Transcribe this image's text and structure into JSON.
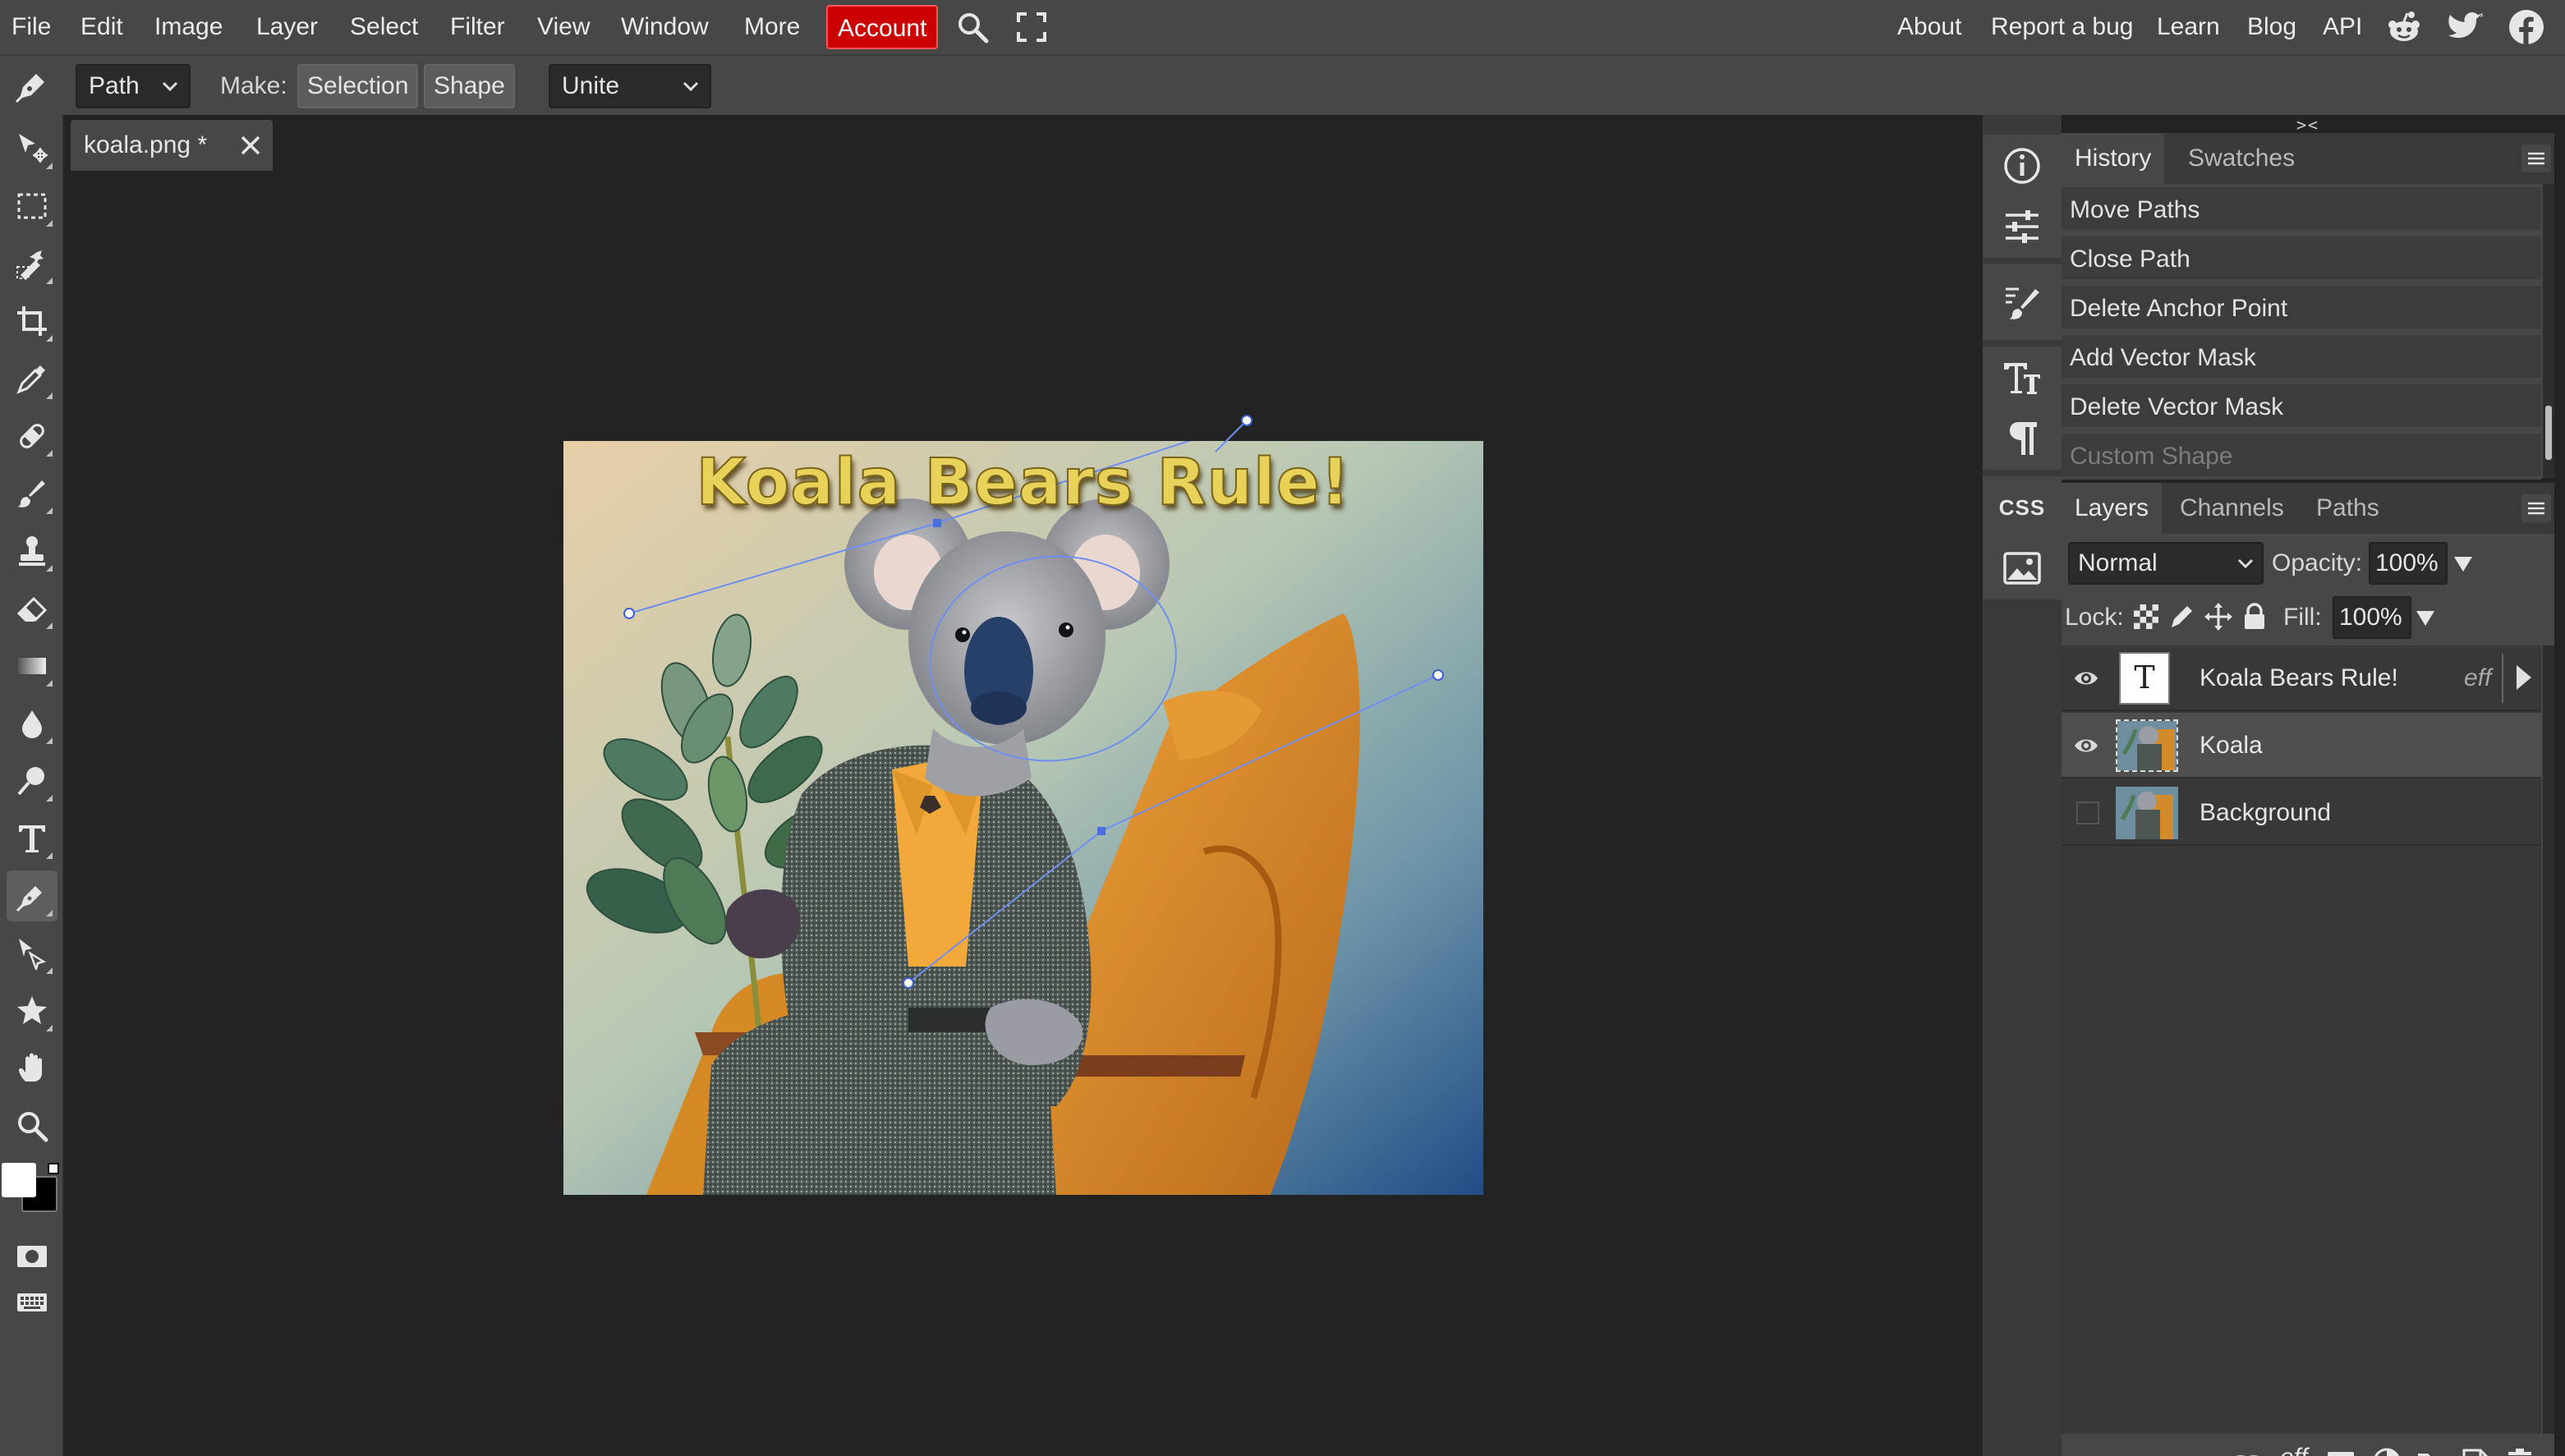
{
  "menu": {
    "items": [
      "File",
      "Edit",
      "Image",
      "Layer",
      "Select",
      "Filter",
      "View",
      "Window",
      "More"
    ],
    "account": "Account",
    "right_links": [
      "About",
      "Report a bug",
      "Learn",
      "Blog",
      "API"
    ],
    "icons": [
      "search-icon",
      "fullscreen-icon",
      "reddit-icon",
      "twitter-icon",
      "facebook-icon"
    ]
  },
  "options": {
    "mode": "Path",
    "make_label": "Make:",
    "selection_button": "Selection",
    "shape_button": "Shape",
    "combine": "Unite"
  },
  "tools": [
    "pen-tool",
    "move",
    "marquee",
    "quick-select",
    "crop",
    "eyedropper",
    "healing",
    "brush",
    "clone-stamp",
    "eraser",
    "gradient",
    "blur",
    "dodge",
    "type",
    "pen",
    "path-select",
    "custom-shape",
    "hand",
    "zoom"
  ],
  "colors": {
    "foreground": "#ffffff",
    "background": "#000000",
    "account_red": "#cc0000",
    "path_blue": "#6f8ff0"
  },
  "document": {
    "tab_title": "koala.png *",
    "canvas_text": "Koala Bears Rule!"
  },
  "side_strip": {
    "collapse_left": "<>",
    "collapse_right": "><",
    "css_label": "CSS"
  },
  "history": {
    "tabs": [
      "History",
      "Swatches"
    ],
    "items": [
      "Move Paths",
      "Close Path",
      "Delete Anchor Point",
      "Add Vector Mask",
      "Delete Vector Mask",
      "Custom Shape"
    ]
  },
  "layers": {
    "tabs": [
      "Layers",
      "Channels",
      "Paths"
    ],
    "blend_mode": "Normal",
    "opacity_label": "Opacity:",
    "opacity": "100%",
    "lock_label": "Lock:",
    "fill_label": "Fill:",
    "fill": "100%",
    "text_thumb": "T",
    "items": [
      {
        "name": "Koala Bears Rule!",
        "type": "text",
        "visible": true,
        "effects": "eff"
      },
      {
        "name": "Koala",
        "type": "image",
        "visible": true,
        "selected": true
      },
      {
        "name": "Background",
        "type": "image",
        "visible": false
      }
    ],
    "footer_effects": "eff"
  }
}
